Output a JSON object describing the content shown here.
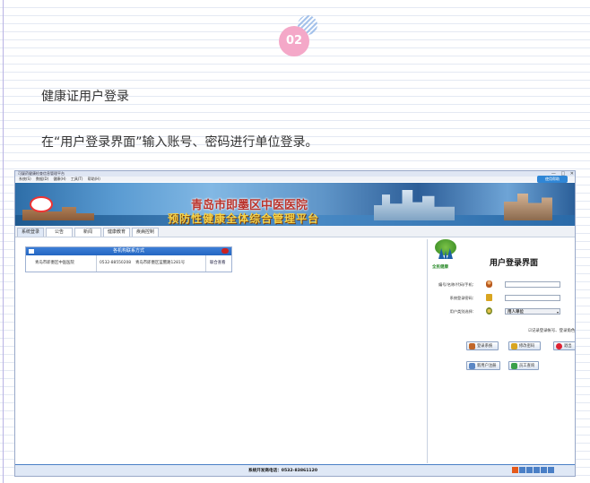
{
  "article": {
    "step_badge": "02",
    "heading": "健康证用户登录",
    "paragraph": "在“用户登录界面”输入账号、密码进行单位登录。"
  },
  "app": {
    "window_title": "可疑药健康检查信息管理平台",
    "menu": [
      "系统(S)",
      "数据(D)",
      "健康(H)",
      "工具(T)",
      "帮助(H)"
    ],
    "help_button": "使用帮助",
    "banner": {
      "hospital_name": "青岛市即墨区中医医院",
      "platform_name": "预防性健康全体综合管理平台"
    },
    "tabs": [
      "系统登录",
      "公告",
      "新闻",
      "健康教育",
      "疾病控制"
    ],
    "contact_table": {
      "title": "各机构联系方式",
      "rows": [
        {
          "org": "青岛市即墨区中医医院",
          "phone": "0532-88550208",
          "address": "青岛市即墨区蓝鳌路1281号",
          "action": "联合查看"
        }
      ]
    },
    "login": {
      "logo_label": "全民健康",
      "title": "用户登录界面",
      "account_label": "编号/名称/代码/手机：",
      "account_value": "",
      "password_label": "系统登录密码：",
      "password_value": "",
      "role_label": "用户类别选择：",
      "role_value": "用人单位",
      "remember_label": "记录登录帐号、登录角色",
      "buttons": {
        "login": "登录系统",
        "change_password": "修改密码",
        "exit": "退出",
        "register": "新用户注册",
        "employee_query": "员工查询"
      }
    },
    "statusbar": {
      "hotline": "系统开发商电话：0532-83861120"
    },
    "colors": {
      "header_blue": "#2466c2",
      "hospital_name": "#b9332c",
      "platform_name": "#f5d24a",
      "badge": "#f4a8c8"
    }
  }
}
